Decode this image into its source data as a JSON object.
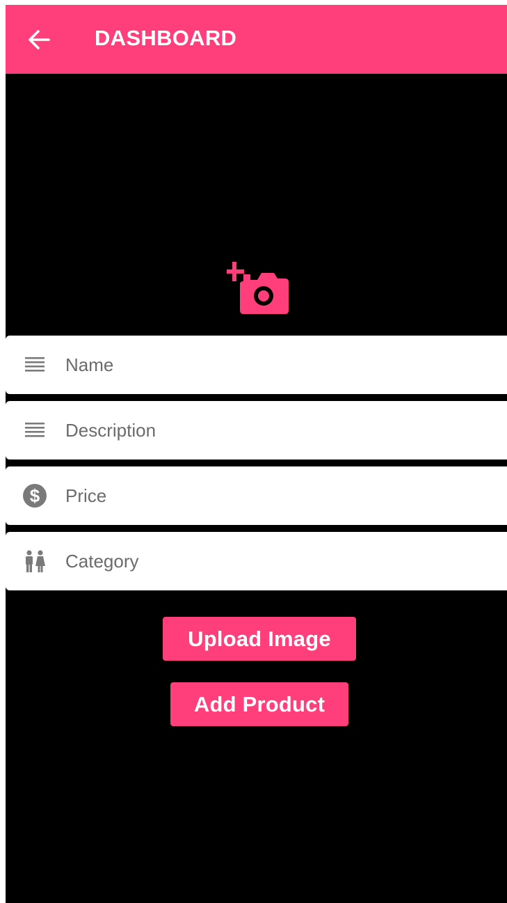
{
  "colors": {
    "accent": "#ff3f7b",
    "background": "#000000",
    "field_background": "#ffffff",
    "icon_gray": "#7a7a7a"
  },
  "appbar": {
    "title": "DASHBOARD",
    "back_icon": "arrow-back-icon"
  },
  "image_picker": {
    "icon": "add-a-photo-icon"
  },
  "form": {
    "fields": [
      {
        "icon": "notes-icon",
        "placeholder": "Name",
        "value": ""
      },
      {
        "icon": "notes-icon",
        "placeholder": "Description",
        "value": ""
      },
      {
        "icon": "dollar-icon",
        "placeholder": "Price",
        "value": ""
      },
      {
        "icon": "people-icon",
        "placeholder": "Category",
        "value": ""
      }
    ]
  },
  "actions": {
    "upload_label": "Upload Image",
    "add_label": "Add Product"
  }
}
